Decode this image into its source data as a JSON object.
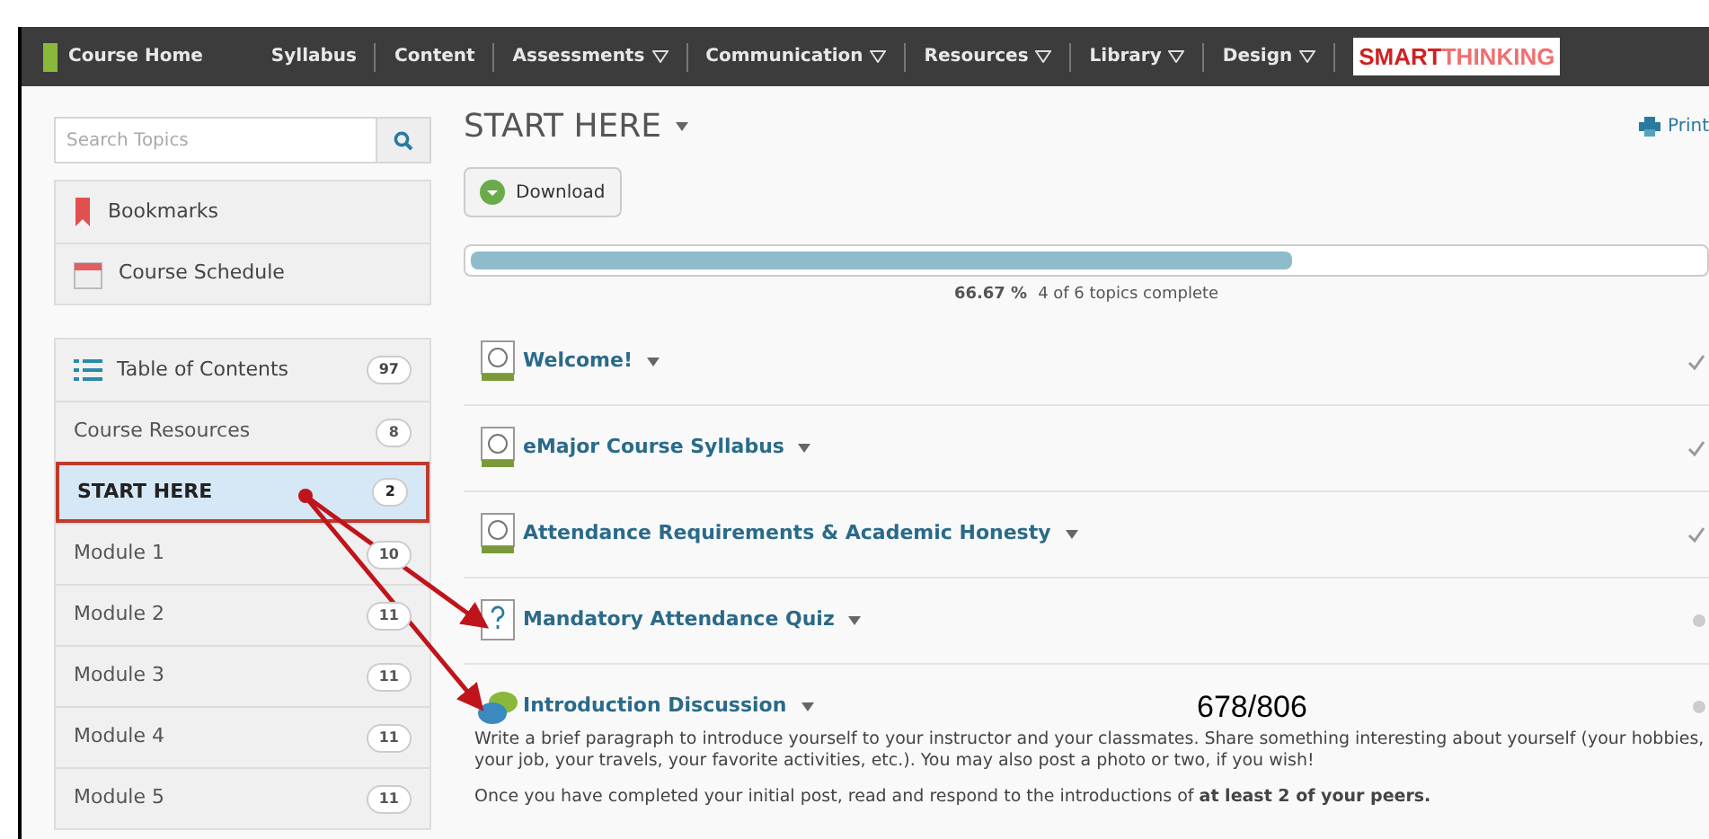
{
  "navbar": {
    "home": "Course Home",
    "items": [
      {
        "label": "Syllabus",
        "has_menu": false
      },
      {
        "label": "Content",
        "has_menu": false
      },
      {
        "label": "Assessments",
        "has_menu": true
      },
      {
        "label": "Communication",
        "has_menu": true
      },
      {
        "label": "Resources",
        "has_menu": true
      },
      {
        "label": "Library",
        "has_menu": true
      },
      {
        "label": "Design",
        "has_menu": true
      }
    ],
    "brand": {
      "part_1": "SMART",
      "part_2": "THINKING"
    }
  },
  "sidebar": {
    "search": {
      "placeholder": "Search Topics"
    },
    "links": [
      {
        "kind": "bookmark",
        "label": "Bookmarks"
      },
      {
        "kind": "calendar",
        "label": "Course Schedule"
      }
    ],
    "toc": {
      "label": "Table of Contents",
      "count": "97"
    },
    "modules": [
      {
        "label": "Course Resources",
        "count": "8",
        "selected": false
      },
      {
        "label": "START HERE",
        "count": "2",
        "selected": true
      },
      {
        "label": "Module 1",
        "count": "10",
        "selected": false
      },
      {
        "label": "Module 2",
        "count": "11",
        "selected": false
      },
      {
        "label": "Module 3",
        "count": "11",
        "selected": false
      },
      {
        "label": "Module 4",
        "count": "11",
        "selected": false
      },
      {
        "label": "Module 5",
        "count": "11",
        "selected": false
      }
    ]
  },
  "main": {
    "title": "START HERE",
    "print": "Print",
    "download": "Download",
    "progress": {
      "level": 0.6667,
      "percent": "66.67 %",
      "summary": "4 of 6 topics complete"
    },
    "topics": [
      {
        "kind": "page",
        "title": "Welcome!",
        "completed": true
      },
      {
        "kind": "page",
        "title": "eMajor Course Syllabus",
        "completed": true
      },
      {
        "kind": "page",
        "title": "Attendance Requirements & Academic Honesty",
        "completed": true
      },
      {
        "kind": "quiz",
        "title": "Mandatory Attendance Quiz",
        "completed": false
      },
      {
        "kind": "discussion",
        "title": "Introduction Discussion",
        "completed": false
      }
    ],
    "description": [
      "Write a brief paragraph to introduce yourself to your instructor and your classmates.  Share something interesting about yourself (your hobbies, your job, your travels, your favorite activities, etc.). You may also post a photo or two, if you wish!",
      "Once you have completed your initial post, read and respond to the introductions of **at least 2 of your peers.**"
    ]
  },
  "page_counter": "678/806"
}
